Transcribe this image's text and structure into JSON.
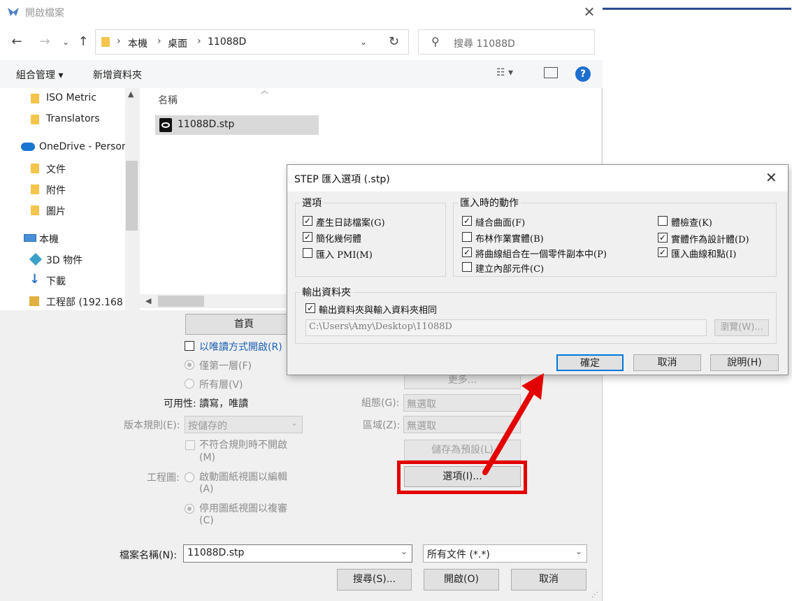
{
  "open_dialog": {
    "title": "開啟檔案",
    "breadcrumb": [
      "本機",
      "桌面",
      "11088D"
    ],
    "search_placeholder": "搜尋 11088D",
    "commands": {
      "organize": "組合管理 ▾",
      "new_folder": "新增資料夾"
    },
    "nav_items": [
      {
        "label": "ISO Metric",
        "icon": "folder-icon"
      },
      {
        "label": "Translators",
        "icon": "folder-icon"
      },
      {
        "label": "OneDrive - Person",
        "icon": "cloud-icon"
      },
      {
        "label": "文件",
        "icon": "folder-icon"
      },
      {
        "label": "附件",
        "icon": "folder-icon"
      },
      {
        "label": "圖片",
        "icon": "folder-icon"
      },
      {
        "label": "本機",
        "icon": "computer-icon"
      },
      {
        "label": "3D 物件",
        "icon": "cube-icon"
      },
      {
        "label": "下載",
        "icon": "download-icon"
      },
      {
        "label": "工程部 (192.168",
        "icon": "network-drive-icon"
      }
    ],
    "column_header": "名稱",
    "files": [
      {
        "name": "11088D.stp"
      }
    ],
    "options": {
      "home_button": "首頁",
      "read_only": "以唯讀方式開啟(R)",
      "first_level": "僅第一層(F)",
      "all_levels": "所有層(V)",
      "availability": "可用性: 讀寫，唯讀",
      "version_rule_label": "版本規則(E):",
      "version_rule_value": "按儲存的",
      "no_open_label": "不符合規則時不開啟",
      "no_open_key": "(M)",
      "drawing_label": "工程圖:",
      "activate_sheet": "啟動圖紙視圖以編輯",
      "activate_sheet_key": "(A)",
      "disable_sheet": "停用圖紙視圖以複審",
      "disable_sheet_key": "(C)",
      "more_button": "更多...",
      "config_label": "組態(G):",
      "config_value": "無選取",
      "region_label": "區域(Z):",
      "region_value": "無選取",
      "save_default_button": "儲存為預設(L)",
      "options_button": "選項(I)..."
    },
    "filename_label": "檔案名稱(N):",
    "filename_value": "11088D.stp",
    "filetype_value": "所有文件 (*.*)",
    "buttons": {
      "search": "搜尋(S)...",
      "open": "開啟(O)",
      "cancel": "取消"
    }
  },
  "step_dialog": {
    "title": "STEP 匯入選項 (.stp)",
    "group_options": "選項",
    "options": [
      {
        "label": "產生日誌檔案(G)",
        "checked": true
      },
      {
        "label": "簡化幾何體",
        "checked": true
      },
      {
        "label": "匯入 PMI(M)",
        "checked": false
      }
    ],
    "group_actions": "匯入時的動作",
    "actions_left": [
      {
        "label": "縫合曲面(F)",
        "checked": true
      },
      {
        "label": "布林作業實體(B)",
        "checked": false
      },
      {
        "label": "將曲線組合在一個零件副本中(P)",
        "checked": true
      },
      {
        "label": "建立內部元件(C)",
        "checked": false
      }
    ],
    "actions_right": [
      {
        "label": "體檢查(K)",
        "checked": false
      },
      {
        "label": "實體作為設計體(D)",
        "checked": true
      },
      {
        "label": "匯入曲線和點(I)",
        "checked": true
      }
    ],
    "group_output": "輸出資料夾",
    "same_folder": "輸出資料夾與輸入資料夾相同",
    "path": "C:\\Users\\Amy\\Desktop\\11088D",
    "browse": "瀏覽(W)...",
    "ok": "確定",
    "cancel": "取消",
    "help": "說明(H)"
  },
  "colors": {
    "accent_blue": "#2b4a8f",
    "annotation_red": "#e30000"
  }
}
